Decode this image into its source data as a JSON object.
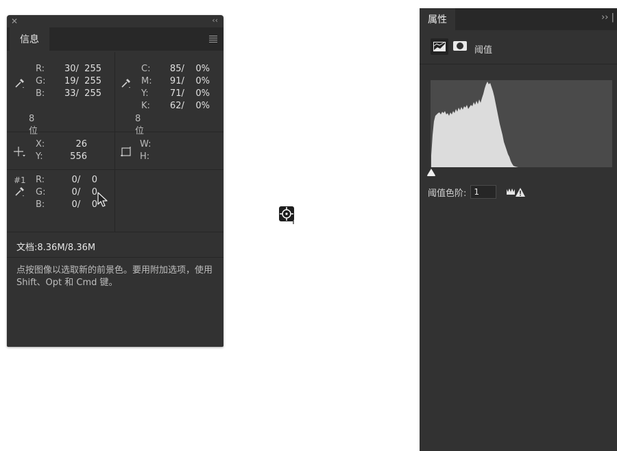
{
  "info_panel": {
    "tab_label": "信息",
    "rgb": {
      "labels": [
        "R:",
        "G:",
        "B:"
      ],
      "values": [
        "30/  255",
        "19/  255",
        "33/  255"
      ],
      "bit_depth": "8 位"
    },
    "cmyk": {
      "labels": [
        "C:",
        "M:",
        "Y:",
        "K:"
      ],
      "values": [
        "85/    0%",
        "91/    0%",
        "71/    0%",
        "62/    0%"
      ],
      "bit_depth": "8 位"
    },
    "position": {
      "x_label": "X:",
      "x_value": "26",
      "y_label": "Y:",
      "y_value": "556"
    },
    "size": {
      "w_label": "W:",
      "h_label": "H:"
    },
    "sampler": {
      "id": "#1",
      "labels": [
        "R:",
        "G:",
        "B:"
      ],
      "values": [
        "0/    0",
        "0/    0",
        "0/    0"
      ]
    },
    "document": "文档:8.36M/8.36M",
    "hint": "点按图像以选取新的前景色。要用附加选项，使用 Shift、Opt 和 Cmd 键。"
  },
  "properties_panel": {
    "tab_label": "属性",
    "adjustment_label": "阈值",
    "threshold_level_label": "阈值色阶:",
    "threshold_level_value": "1"
  },
  "colors": {
    "panel_bg": "#323232",
    "tabbar_bg": "#282828",
    "histogram_bg": "#4a4a4a",
    "histogram_fill": "#dcdcdc",
    "warning": "#e0e0e0"
  },
  "icons": [
    "close-icon",
    "collapse-icon",
    "panel-menu-icon",
    "eyedropper-icon",
    "crosshair-icon",
    "selection-size-icon",
    "color-sampler-icon",
    "mouse-cursor-icon",
    "target-icon",
    "panel-expand-icon",
    "adjustment-layer-icon",
    "layer-mask-icon",
    "slider-handle-icon",
    "clip-warning-icon"
  ]
}
